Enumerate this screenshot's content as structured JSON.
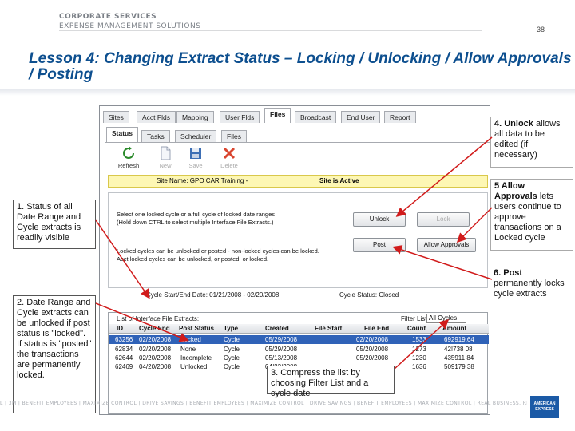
{
  "header": {
    "brand_line1": "CORPORATE SERVICES",
    "brand_line2": "EXPENSE MANAGEMENT SOLUTIONS",
    "page_number": "38",
    "title": "Lesson 4: Changing Extract Status – Locking / Unlocking / Allow Approvals / Posting"
  },
  "app": {
    "top_tabs": [
      "Sites",
      "Acct Flds",
      "Mapping",
      "User Flds",
      "Files",
      "Broadcast",
      "End User",
      "Report"
    ],
    "active_top_tab": "Files",
    "sub_tabs": [
      "Status",
      "Tasks",
      "Scheduler",
      "Files"
    ],
    "active_sub_tab": "Status",
    "toolbar": {
      "refresh": "Refresh",
      "new": "New",
      "save": "Save",
      "delete": "Delete"
    },
    "site_bar": {
      "site_name": "Site Name: GPO CAR Training -",
      "status": "Site is Active"
    },
    "panel": {
      "instr_line1": "Select one locked cycle or a full cycle of locked date ranges",
      "instr_line2": "(Hold down CTRL to select multiple Interface File Extracts.)",
      "note_line1": "Locked cycles can be unlocked or posted - non-locked cycles can be locked.",
      "note_line2": "Acct locked cycles can be unlocked, or posted, or locked.",
      "unlock_label": "Unlock",
      "lock_label": "Lock",
      "post_label": "Post",
      "allow_approvals_label": "Allow Approvals"
    },
    "cycle_info": {
      "cycle_dates": "Cycle Start/End Date: 01/21/2008 - 02/20/2008",
      "cycle_status": "Cycle Status: Closed"
    },
    "grid": {
      "list_label": "List of Interface File Extracts:",
      "filter_label": "Filter List",
      "filter_value": "All Cycles",
      "columns": [
        "ID",
        "Cycle End",
        "Post Status",
        "Type",
        "Created",
        "File Start",
        "File End",
        "Count",
        "Amount"
      ],
      "rows": [
        [
          "63256",
          "02/20/2008",
          "Locked",
          "Cycle",
          "05/29/2008",
          "",
          "02/20/2008",
          "1533",
          "692919.64"
        ],
        [
          "62834",
          "02/20/2008",
          "None",
          "Cycle",
          "05/29/2008",
          "",
          "05/20/2008",
          "1273",
          "42!738 08"
        ],
        [
          "62644",
          "02/20/2008",
          "Incomplete",
          "Cycle",
          "05/13/2008",
          "",
          "05/20/2008",
          "1230",
          "435911 84"
        ],
        [
          "62469",
          "04/20/2008",
          "Unlocked",
          "Cycle",
          "04/22/2008",
          "",
          "",
          "1636",
          "509179 38"
        ]
      ]
    }
  },
  "callouts": {
    "c1": "1. Status of all Date Range and Cycle extracts is readily visible",
    "c2": "2. Date Range and Cycle extracts can be unlocked if post status is \"locked\". If status is \"posted\" the transactions are permanently locked.",
    "c3": "3. Compress the list by choosing Filter List and a cycle date",
    "c4_bold": "4. Unlock",
    "c4_rest": "allows all data to be edited (if necessary)",
    "c5_bold": "5 Allow Approvals",
    "c5_rest": "lets users continue to approve transactions on a Locked cycle",
    "c6_bold": "6. Post",
    "c6_rest": "permanently locks cycle extracts"
  },
  "footer": {
    "text": "L | 3M | BENEFIT EMPLOYEES | MAXIMIZE CONTROL | DRIVE SAVINGS | BENEFIT EMPLOYEES | MAXIMIZE CONTROL | DRIVE SAVINGS | BENEFIT EMPLOYEES | MAXIMIZE CONTROL | REAL BUSINESS. REAL SOLUTIONS.™",
    "logo_text": "AMERICAN EXPRESS"
  },
  "colors": {
    "title": "#0d4f8f",
    "selected_row": "#2f62b8",
    "site_bar": "#fdf7b4",
    "arrow": "#d11b1b"
  }
}
